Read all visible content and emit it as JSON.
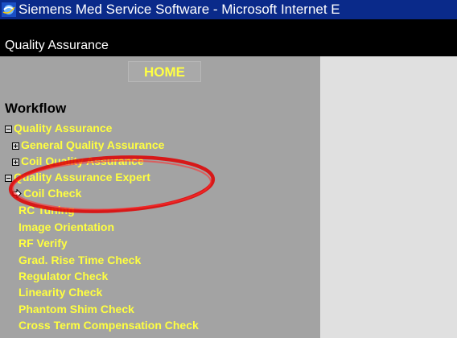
{
  "window": {
    "title": "Siemens Med Service Software - Microsoft Internet E"
  },
  "appbar": {
    "title": "Quality Assurance"
  },
  "nav": {
    "home_label": "HOME"
  },
  "workflow": {
    "heading": "Workflow",
    "items": [
      {
        "label": "Quality Assurance",
        "marker": "minus-box"
      },
      {
        "label": "General Quality Assurance",
        "marker": "plus-box"
      },
      {
        "label": "Coil Quality Assurance",
        "marker": "plus-box"
      },
      {
        "label": "Quality Assurance Expert",
        "marker": "minus-box"
      },
      {
        "label": "Coil Check",
        "marker": "arrow"
      },
      {
        "label": "RC Tuning",
        "marker": "none"
      },
      {
        "label": "Image Orientation",
        "marker": "none"
      },
      {
        "label": "RF Verify",
        "marker": "none"
      },
      {
        "label": "Grad. Rise Time Check",
        "marker": "none"
      },
      {
        "label": "Regulator Check",
        "marker": "none"
      },
      {
        "label": "Linearity Check",
        "marker": "none"
      },
      {
        "label": "Phantom Shim Check",
        "marker": "none"
      },
      {
        "label": "Cross Term Compensation Check",
        "marker": "none"
      }
    ]
  },
  "colors": {
    "link": "#ffff40",
    "sidebar": "#a3a3a3",
    "titlebar": "#0a2a8a",
    "annotation": "#e00000"
  }
}
